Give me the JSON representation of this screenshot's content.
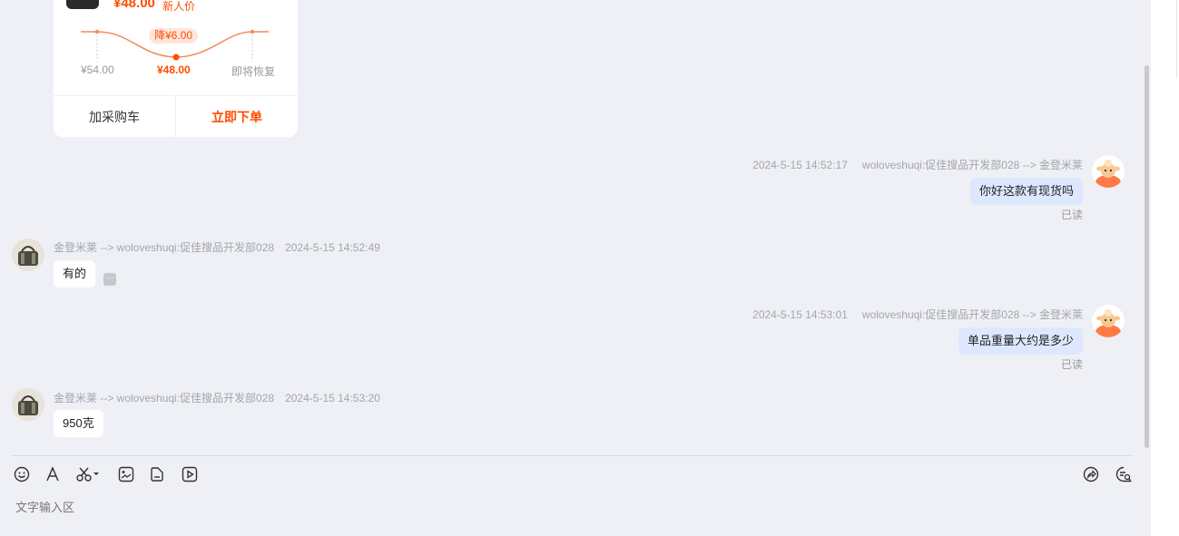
{
  "product_card": {
    "price": "¥48.00",
    "price_tag": "新人价",
    "drop_badge": "降¥6.00",
    "price_before": "¥54.00",
    "price_now": "¥48.00",
    "price_after": "即将恢复",
    "add_to_cart": "加采购车",
    "order_now": "立即下单"
  },
  "messages": [
    {
      "direction": "out",
      "time": "2024-5-15 14:52:17",
      "route": "woloveshuqi:促佳搜品开发部028 --> 金登米莱",
      "text": "你好这款有现货吗",
      "status": "已读"
    },
    {
      "direction": "in",
      "route": "金登米莱 --> woloveshuqi:促佳搜品开发部028",
      "time": "2024-5-15 14:52:49",
      "text": "有的",
      "more": "···"
    },
    {
      "direction": "out",
      "time": "2024-5-15 14:53:01",
      "route": "woloveshuqi:促佳搜品开发部028 --> 金登米莱",
      "text": "单品重量大约是多少",
      "status": "已读"
    },
    {
      "direction": "in",
      "route": "金登米莱 --> woloveshuqi:促佳搜品开发部028",
      "time": "2024-5-15 14:53:20",
      "text": "950克"
    }
  ],
  "toolbar": {
    "left_icons": [
      "emoji-icon",
      "font-icon",
      "scissors-icon",
      "image-icon",
      "file-icon",
      "video-icon"
    ],
    "right_icons": [
      "share-icon",
      "chat-settings-icon"
    ]
  },
  "input": {
    "placeholder": "文字输入区"
  },
  "colors": {
    "accent": "#ff4d00",
    "background": "#eff0f5",
    "outgoing_bubble": "#dde8ff",
    "incoming_bubble": "#ffffff"
  }
}
